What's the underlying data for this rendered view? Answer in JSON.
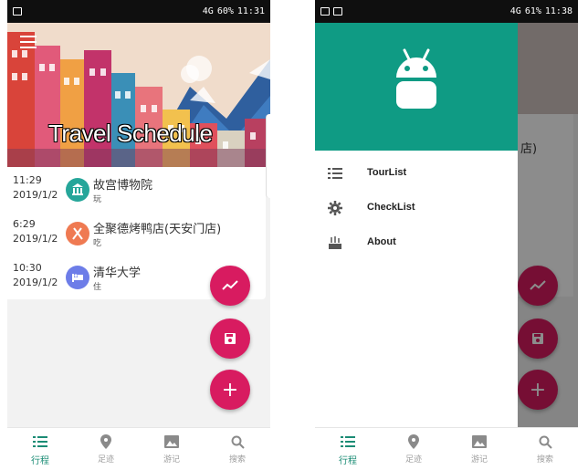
{
  "screen1": {
    "status": {
      "time": "11:31",
      "battery": "60%",
      "network": "4G"
    },
    "header": {
      "title": "Travel Schedule"
    },
    "items": [
      {
        "time": "11:29",
        "date": "2019/1/2",
        "name": "故宫博物院",
        "kind": "玩",
        "icon": "museum-icon",
        "color": "#26a69a"
      },
      {
        "time": "6:29",
        "date": "2019/1/2",
        "name": "全聚德烤鸭店(天安门店)",
        "kind": "吃",
        "icon": "restaurant-icon",
        "color": "#ef7a52"
      },
      {
        "time": "10:30",
        "date": "2019/1/2",
        "name": "清华大学",
        "kind": "住",
        "icon": "hotel-icon",
        "color": "#6d7de8"
      }
    ],
    "fabs": {
      "chart": "trending-icon",
      "save": "save-icon",
      "add": "+"
    }
  },
  "screen2": {
    "status": {
      "time": "11:38",
      "battery": "61%",
      "network": "4G"
    },
    "drawer": {
      "items": [
        {
          "label": "TourList",
          "icon": "list-icon"
        },
        {
          "label": "CheckList",
          "icon": "gear-icon"
        },
        {
          "label": "About",
          "icon": "about-icon"
        }
      ]
    },
    "background_text": "店)"
  },
  "nav": {
    "items": [
      {
        "label": "行程",
        "icon": "list-icon"
      },
      {
        "label": "足迹",
        "icon": "pin-icon"
      },
      {
        "label": "游记",
        "icon": "photo-icon"
      },
      {
        "label": "搜索",
        "icon": "search-icon"
      }
    ]
  },
  "colors": {
    "accent": "#d81b60",
    "primary": "#0f9b84",
    "nav_active": "#1b8c75"
  }
}
